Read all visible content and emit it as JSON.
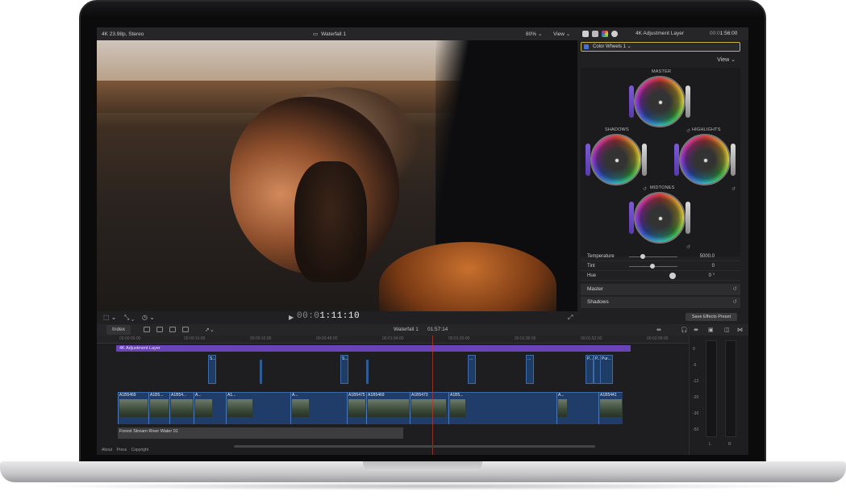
{
  "viewer": {
    "format": "4K 23.98p, Stereo",
    "clip_title": "Waterfall 1",
    "zoom": "80%",
    "view_label": "View",
    "timecode_dim": "00:0",
    "timecode": "1:11:10"
  },
  "inspector": {
    "layer_name": "4K Adjustment Layer",
    "timecode_dim": "00:0",
    "timecode": "1:56:00",
    "effect_name": "Color Wheels 1",
    "view_label": "View",
    "wheels": {
      "master": "MASTER",
      "shadows": "SHADOWS",
      "highlights": "HIGHLIGHTS",
      "midtones": "MIDTONES"
    },
    "params": [
      {
        "name": "Temperature",
        "value": "5000.0"
      },
      {
        "name": "Tint",
        "value": "0"
      },
      {
        "name": "Hue",
        "value": "0 °"
      }
    ],
    "sections": [
      "Master",
      "Shadows"
    ],
    "save_preset": "Save Effects Preset"
  },
  "timeline": {
    "index_label": "Index",
    "project_name": "Waterfall 1",
    "project_duration": "01:57:14",
    "adjustment_layer": "4K Adjustment Layer",
    "ruler": [
      "00:00:00:00",
      "00:00:16:00",
      "00:00:32:00",
      "00:00:48:00",
      "00:01:04:00",
      "00:01:20:00",
      "00:01:36:00",
      "00:01:52:00",
      "00:02:08:00"
    ],
    "connected_clips": [
      "S...",
      "S...",
      "...",
      "...",
      "P...",
      "P...",
      "Pur..."
    ],
    "primary_clips": [
      "A1B5469",
      "A1B5...",
      "A1B54...",
      "A...",
      "A1...",
      "A...",
      "A1B5475",
      "A1B5469",
      "A1B5473",
      "A1B5...",
      "A...",
      "A1B5441"
    ],
    "audio_clip": "Forest Stream River Water 01",
    "meter_scale": [
      "0",
      "-6",
      "-12",
      "-20",
      "-30",
      "-50"
    ],
    "meter_channels": [
      "L",
      "R"
    ]
  },
  "footer": [
    "About",
    "Press",
    "Copyright"
  ]
}
